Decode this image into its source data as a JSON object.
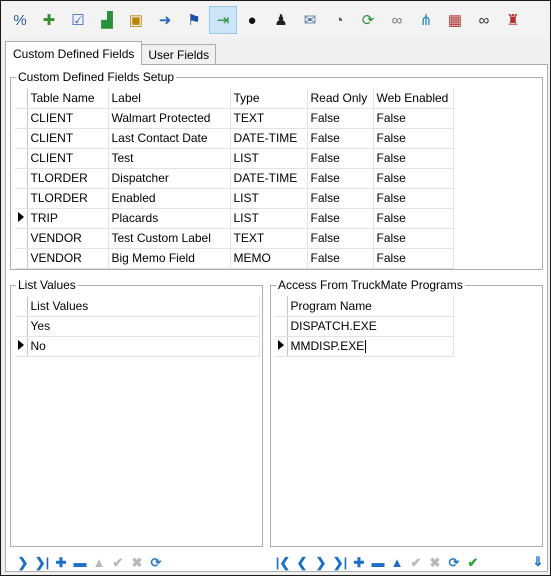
{
  "toolbar": {
    "buttons": [
      {
        "icon": "percent-icon",
        "glyph": "%",
        "color": "#2a5aa0"
      },
      {
        "icon": "add-document-icon",
        "glyph": "✚",
        "color": "#3a8a3a"
      },
      {
        "icon": "checklist-icon",
        "glyph": "☑",
        "color": "#2f62b8"
      },
      {
        "icon": "chart-icon",
        "glyph": "▟",
        "color": "#2c8f3c"
      },
      {
        "icon": "package-icon",
        "glyph": "▣",
        "color": "#b8860b"
      },
      {
        "icon": "document-arrow-icon",
        "glyph": "➜",
        "color": "#2f62b8"
      },
      {
        "icon": "flag-icon",
        "glyph": "⚑",
        "color": "#1d4fa8"
      },
      {
        "icon": "export-icon",
        "glyph": "⇥",
        "color": "#2c8f3c"
      },
      {
        "icon": "bomb-icon",
        "glyph": "●",
        "color": "#111111"
      },
      {
        "icon": "user-icon",
        "glyph": "♟",
        "color": "#222222"
      },
      {
        "icon": "email-icon",
        "glyph": "✉",
        "color": "#4a6fa5"
      },
      {
        "icon": "gauge-icon",
        "glyph": "◔",
        "color": "#555555"
      },
      {
        "icon": "refresh-icon",
        "glyph": "⟳",
        "color": "#2c8f3c"
      },
      {
        "icon": "link-icon",
        "glyph": "∞",
        "color": "#777777"
      },
      {
        "icon": "network-icon",
        "glyph": "⋔",
        "color": "#1d7fc1"
      },
      {
        "icon": "calendar-icon",
        "glyph": "▦",
        "color": "#b03030"
      },
      {
        "icon": "binoculars-icon",
        "glyph": "∞",
        "color": "#333333"
      },
      {
        "icon": "stamp-icon",
        "glyph": "♜",
        "color": "#b03030"
      }
    ],
    "active_index": 7
  },
  "tabs": [
    {
      "label": "Custom Defined Fields"
    },
    {
      "label": "User Fields"
    }
  ],
  "setup": {
    "title": "Custom Defined Fields Setup",
    "columns": [
      "Table Name",
      "Label",
      "Type",
      "Read Only",
      "Web Enabled"
    ],
    "rows": [
      [
        "CLIENT",
        "Walmart Protected",
        "TEXT",
        "False",
        "False"
      ],
      [
        "CLIENT",
        "Last Contact Date",
        "DATE-TIME",
        "False",
        "False"
      ],
      [
        "CLIENT",
        "Test",
        "LIST",
        "False",
        "False"
      ],
      [
        "TLORDER",
        "Dispatcher",
        "DATE-TIME",
        "False",
        "False"
      ],
      [
        "TLORDER",
        "Enabled",
        "LIST",
        "False",
        "False"
      ],
      [
        "TRIP",
        "Placards",
        "LIST",
        "False",
        "False"
      ],
      [
        "VENDOR",
        "Test Custom Label",
        "TEXT",
        "False",
        "False"
      ],
      [
        "VENDOR",
        "Big Memo Field",
        "MEMO",
        "False",
        "False"
      ]
    ],
    "current_row": 5
  },
  "list_values": {
    "title": "List Values",
    "column": "List Values",
    "rows": [
      "Yes",
      "No"
    ],
    "current_row": 1
  },
  "access": {
    "title": "Access From TruckMate Programs",
    "column": "Program Name",
    "rows": [
      "DISPATCH.EXE",
      "MMDISP.EXE"
    ],
    "current_row": 1
  }
}
